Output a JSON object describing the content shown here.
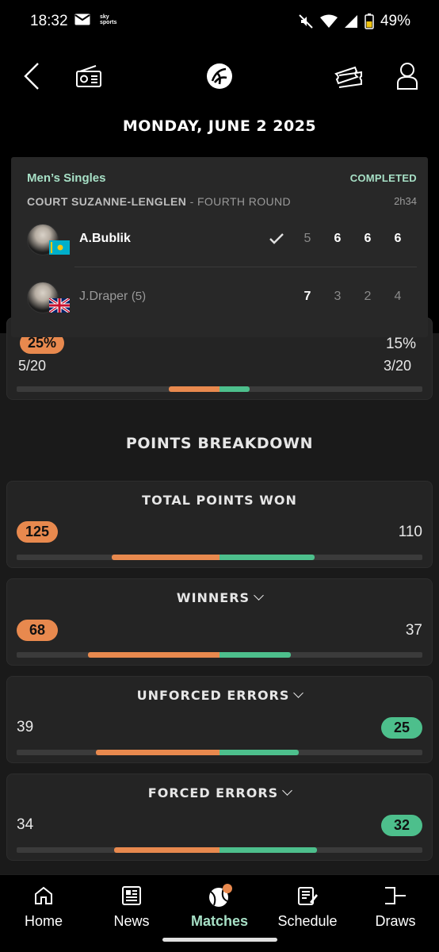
{
  "status_bar": {
    "time": "18:32",
    "battery": "49%",
    "carrier_badge": "sky sports"
  },
  "header": {
    "date": "MONDAY, JUNE 2 2025"
  },
  "match": {
    "category": "Men’s Singles",
    "status": "COMPLETED",
    "court": "COURT SUZANNE-LENGLEN",
    "round": " - FOURTH ROUND",
    "duration": "2h34",
    "players": [
      {
        "name": "A.Bublik",
        "seed": "",
        "winner": true,
        "sets": [
          "5",
          "6",
          "6",
          "6"
        ]
      },
      {
        "name": "J.Draper",
        "seed": "(5)",
        "winner": false,
        "sets": [
          "7",
          "3",
          "2",
          "4"
        ]
      }
    ]
  },
  "partial_stat": {
    "left_pct": "25%",
    "right_pct": "15%",
    "left_value": "5/20",
    "right_value": "3/20",
    "left_fraction": 0.25,
    "right_fraction": 0.15
  },
  "section_title": "POINTS BREAKDOWN",
  "stats": [
    {
      "title": "TOTAL POINTS WON",
      "left": "125",
      "right": "110",
      "leader": "left",
      "expandable": false,
      "left_fraction": 0.53,
      "right_fraction": 0.47
    },
    {
      "title": "WINNERS",
      "left": "68",
      "right": "37",
      "leader": "left",
      "expandable": true,
      "left_fraction": 0.65,
      "right_fraction": 0.35
    },
    {
      "title": "UNFORCED ERRORS",
      "left": "39",
      "right": "25",
      "leader": "right",
      "expandable": true,
      "left_fraction": 0.61,
      "right_fraction": 0.39
    },
    {
      "title": "FORCED ERRORS",
      "left": "34",
      "right": "32",
      "leader": "right",
      "expandable": true,
      "left_fraction": 0.52,
      "right_fraction": 0.48
    }
  ],
  "nav": [
    {
      "label": "Home",
      "icon": "home-icon"
    },
    {
      "label": "News",
      "icon": "news-icon"
    },
    {
      "label": "Matches",
      "icon": "tennis-ball-icon",
      "active": true
    },
    {
      "label": "Schedule",
      "icon": "schedule-icon"
    },
    {
      "label": "Draws",
      "icon": "draws-icon"
    }
  ],
  "colors": {
    "accent": "#a7e0c6",
    "player_one": "#e8894e",
    "player_two": "#4dbf8c"
  }
}
